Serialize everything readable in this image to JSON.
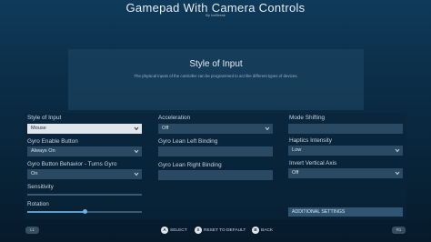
{
  "header": {
    "title": "Gamepad With Camera Controls",
    "author": "By IceBreak"
  },
  "panel": {
    "title": "Style of Input",
    "description": "The physical inputs of the controller can be programmed to act like different types of devices."
  },
  "column1": {
    "style_of_input": {
      "label": "Style of Input",
      "value": "Mouse"
    },
    "gyro_enable": {
      "label": "Gyro Enable Button",
      "value": "Always On"
    },
    "gyro_behavior": {
      "label": "Gyro Button Behavior - Turns Gyro",
      "value": "On"
    },
    "sensitivity": {
      "label": "Sensitivity",
      "level": 0.0
    },
    "rotation": {
      "label": "Rotation",
      "level": 0.5
    }
  },
  "column2": {
    "acceleration": {
      "label": "Acceleration",
      "value": "Off"
    },
    "gyro_lean_left": {
      "label": "Gyro Lean Left Binding"
    },
    "gyro_lean_right": {
      "label": "Gyro Lean Right Binding"
    }
  },
  "column3": {
    "mode_shifting": {
      "label": "Mode Shifting"
    },
    "haptics_intensity": {
      "label": "Haptics Intensity",
      "value": "Low"
    },
    "invert_vertical": {
      "label": "Invert Vertical Axis",
      "value": "Off"
    },
    "additional_settings": "ADDITIONAL SETTINGS"
  },
  "footer": {
    "left_bumper": "L1",
    "right_bumper": "R1",
    "select_label": "SELECT",
    "select_glyph": "A",
    "reset_label": "RESET TO DEFAULT",
    "reset_glyph": "X",
    "back_label": "BACK",
    "back_glyph": "B"
  },
  "colors": {
    "accent": "#5c9ccf",
    "field": "#2a4a63",
    "selected_field": "#dfe6ec"
  }
}
